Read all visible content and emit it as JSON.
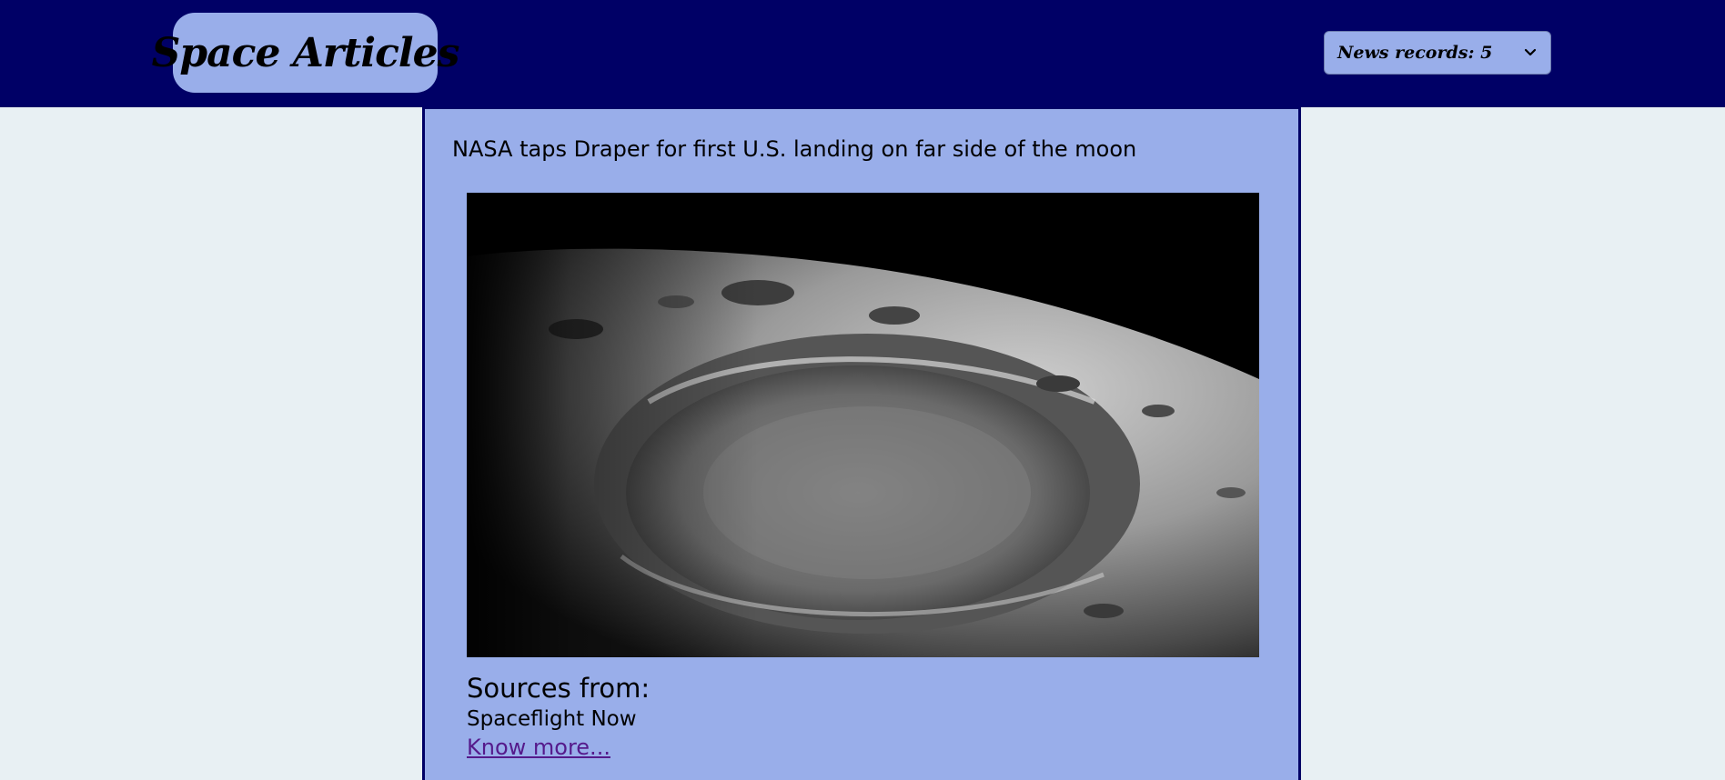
{
  "header": {
    "logo_text": "Space Articles",
    "records_select": {
      "selected_label": "News records: 5",
      "icon": "chevron-down-icon"
    }
  },
  "article": {
    "title": "NASA taps Draper for first U.S. landing on far side of the moon",
    "sources_heading": "Sources from:",
    "source_name": "Spaceflight Now",
    "link_text": "Know more..."
  },
  "colors": {
    "header_bg": "#000066",
    "accent": "#99aeea",
    "page_bg": "#e8f0f3",
    "link": "#551a8b"
  }
}
